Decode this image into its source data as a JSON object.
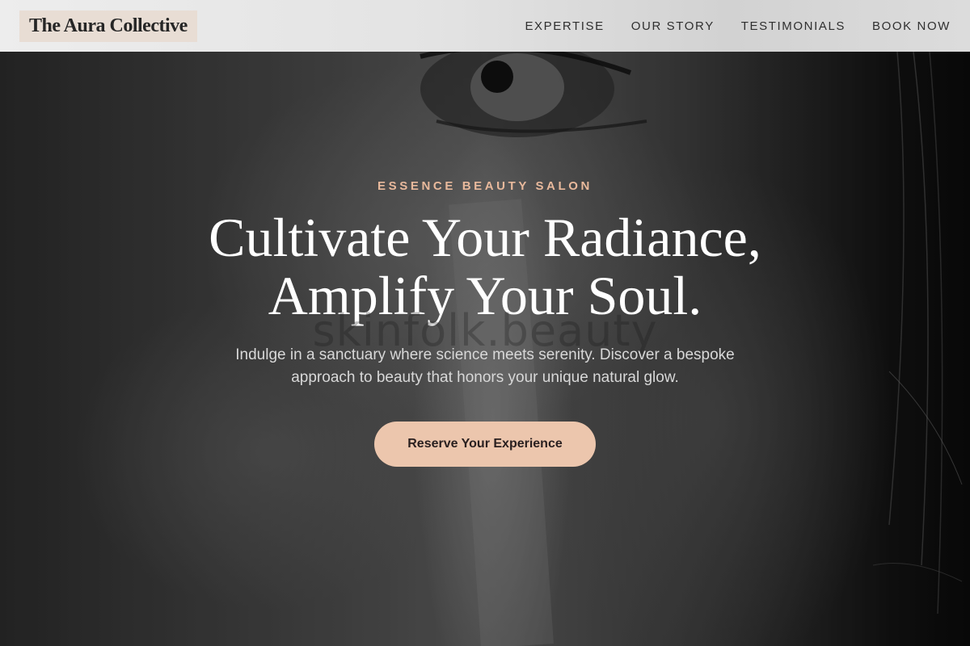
{
  "brand": {
    "name": "The Aura Collective"
  },
  "nav": {
    "items": [
      {
        "label": "EXPERTISE"
      },
      {
        "label": "OUR STORY"
      },
      {
        "label": "TESTIMONIALS"
      },
      {
        "label": "BOOK NOW"
      }
    ]
  },
  "hero": {
    "eyebrow": "ESSENCE BEAUTY SALON",
    "headline_line1": "Cultivate Your Radiance,",
    "headline_line2": "Amplify Your Soul.",
    "watermark": "skinfolk.beauty",
    "subtext": "Indulge in a sanctuary where science meets serenity. Discover a bespoke approach to beauty that honors your unique natural glow.",
    "cta_label": "Reserve Your Experience"
  },
  "colors": {
    "accent": "#ecc6ad",
    "eyebrow": "#e8b99c",
    "logo_bg": "#e8ddd4",
    "nav_bg": "#e3e3e3"
  }
}
